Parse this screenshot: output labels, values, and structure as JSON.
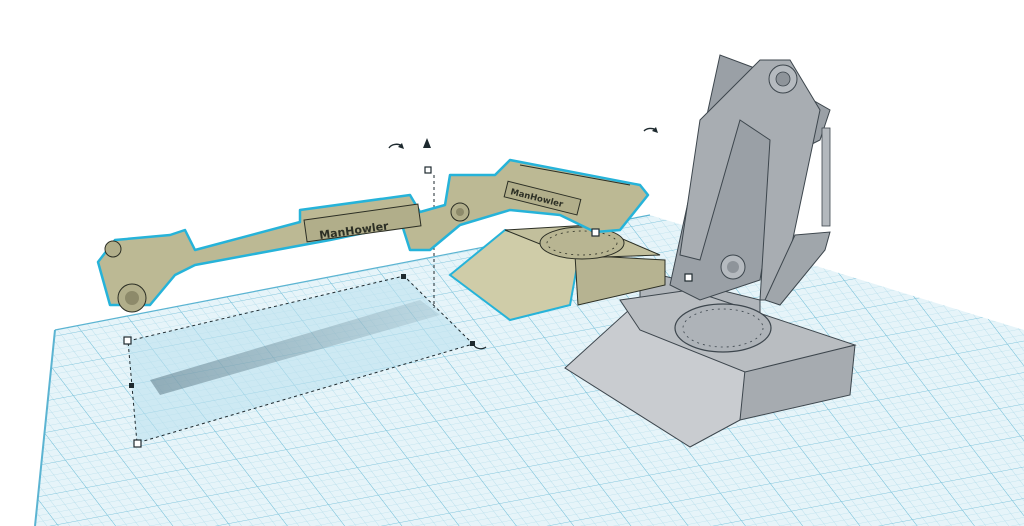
{
  "app": {
    "name": "3D design workplane"
  },
  "workplane": {
    "grid_color": "#7fc6dc",
    "fill_color": "#e3f2f8"
  },
  "arm_selected": {
    "label_upper": "ManHowler",
    "label_lower": "ManHowler",
    "body_color": "#bfbd96",
    "outline_color": "#26b3d9"
  },
  "arm_reference": {
    "body_color": "#9aa0a6"
  },
  "gizmo": {
    "rotate_left_icon": "rotate-arrow-icon",
    "rotate_right_icon": "rotate-arrow-icon",
    "lift_icon": "cone-up-icon",
    "floor_rotate_icon": "rotate-arrow-icon"
  }
}
